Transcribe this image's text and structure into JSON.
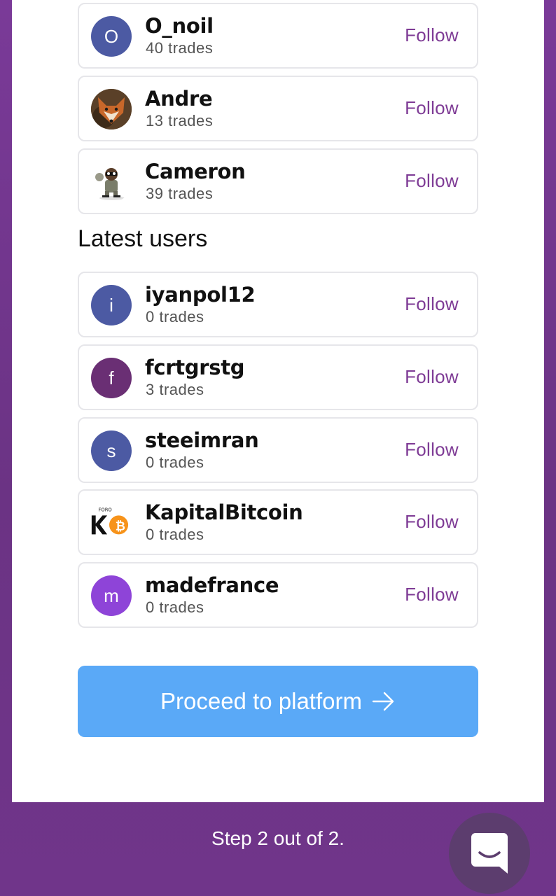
{
  "top_users": [
    {
      "name": "O_noil",
      "trades": "40 trades",
      "avatar_letter": "O",
      "avatar_color": "#4c5aa3",
      "follow_label": "Follow"
    },
    {
      "name": "Andre",
      "trades": "13 trades",
      "avatar_type": "fox-photo",
      "follow_label": "Follow"
    },
    {
      "name": "Cameron",
      "trades": "39 trades",
      "avatar_type": "cartoon-robber",
      "follow_label": "Follow"
    }
  ],
  "latest_section_title": "Latest users",
  "latest_users": [
    {
      "name": "iyanpol12",
      "trades": "0 trades",
      "avatar_letter": "i",
      "avatar_color": "#4c5aa3",
      "follow_label": "Follow"
    },
    {
      "name": "fcrtgrstg",
      "trades": "3 trades",
      "avatar_letter": "f",
      "avatar_color": "#6a2f74",
      "follow_label": "Follow"
    },
    {
      "name": "steeimran",
      "trades": "0 trades",
      "avatar_letter": "s",
      "avatar_color": "#4c5aa3",
      "follow_label": "Follow"
    },
    {
      "name": "KapitalBitcoin",
      "trades": "0 trades",
      "avatar_type": "kapital-bitcoin-logo",
      "logo_text": "FORO",
      "follow_label": "Follow"
    },
    {
      "name": "madefrance",
      "trades": "0 trades",
      "avatar_letter": "m",
      "avatar_color": "#8e44d8",
      "follow_label": "Follow"
    }
  ],
  "proceed_button": {
    "label": "Proceed to platform",
    "icon": "arrow-right-icon",
    "color": "#5aa9f7"
  },
  "step_text": "Step 2 out of 2.",
  "chat_button": {
    "icon": "chat-icon"
  },
  "colors": {
    "accent": "#7e3b95",
    "background": "#7a3a98"
  }
}
